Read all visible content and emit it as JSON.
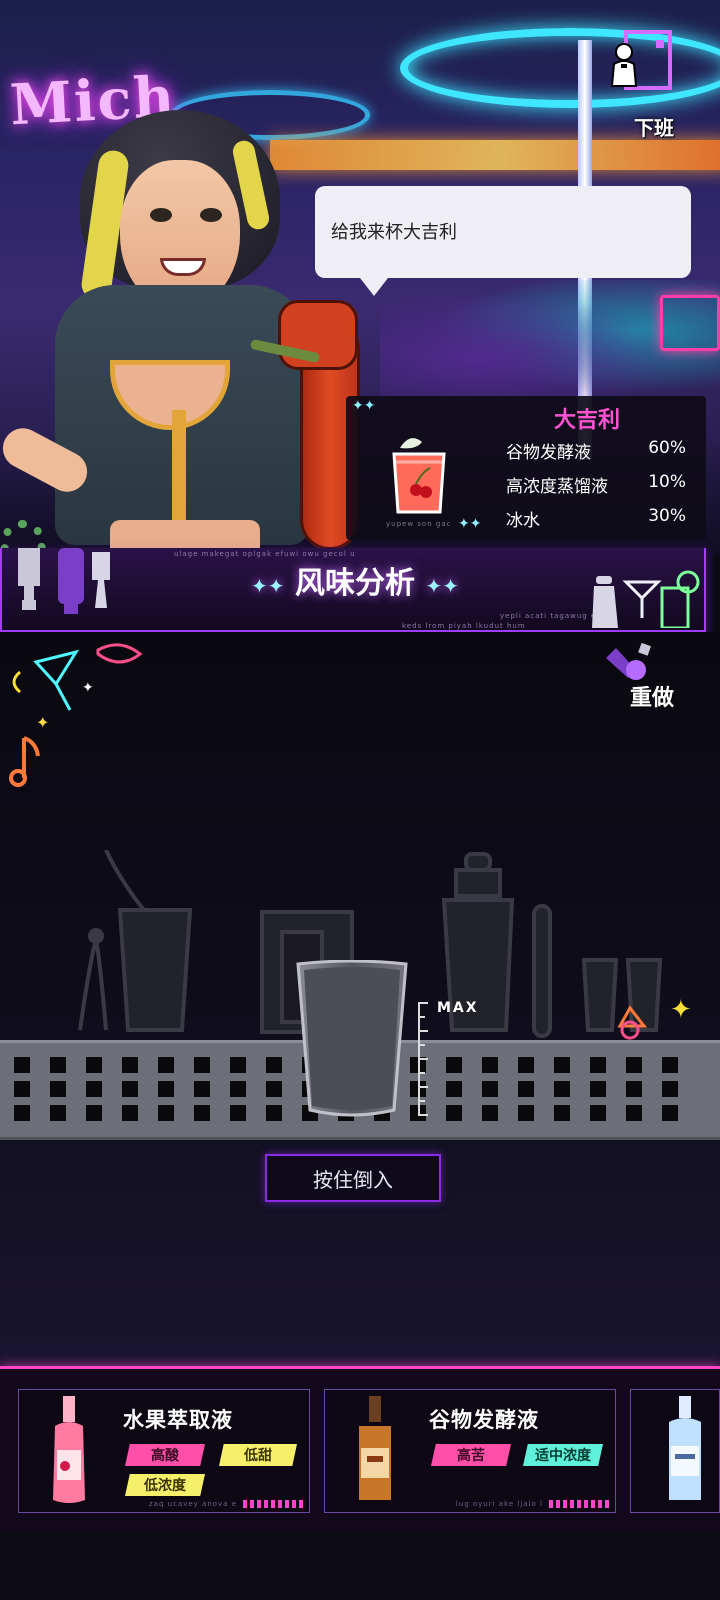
{
  "header": {
    "off_work_label": "下班",
    "off_work_icon": "bartender-door-icon"
  },
  "scene": {
    "neon_sign_text": "Mich",
    "dialogue": "给我来杯大吉利"
  },
  "recipe": {
    "name": "大吉利",
    "ingredients": [
      {
        "name": "谷物发酵液",
        "percent": "60%"
      },
      {
        "name": "高浓度蒸馏液",
        "percent": "10%"
      },
      {
        "name": "冰水",
        "percent": "30%"
      }
    ],
    "caption": "yupew son gac"
  },
  "banner": {
    "title": "风味分析",
    "micro_top": "ulage makegat oplgak efuwi owu gecol u",
    "micro_right": "yepli acati tagawug e",
    "micro_bottom": "keds lrom piyah lkudut hum"
  },
  "controls": {
    "redo_label": "重做",
    "max_label": "MAX",
    "pour_button": "按住倒入"
  },
  "ingredients": [
    {
      "name": "水果萃取液",
      "tags": [
        {
          "text": "高酸",
          "color": "pink"
        },
        {
          "text": "低甜",
          "color": "yellow"
        },
        {
          "text": "低浓度",
          "color": "yellow"
        }
      ],
      "bottle_color": "#ff7aa0",
      "caption": "zaq ucavey anova e"
    },
    {
      "name": "谷物发酵液",
      "tags": [
        {
          "text": "高苦",
          "color": "pink"
        },
        {
          "text": "适中浓度",
          "color": "cyan"
        }
      ],
      "bottle_color": "#c8772a",
      "caption": "lug oyuri ake ljalo l"
    },
    {
      "name": "",
      "tags": [],
      "bottle_color": "#bfe0ff",
      "caption": ""
    }
  ],
  "colors": {
    "accent_pink": "#ff46c8",
    "accent_purple": "#a03cff",
    "recipe_title": "#ff53d4"
  }
}
